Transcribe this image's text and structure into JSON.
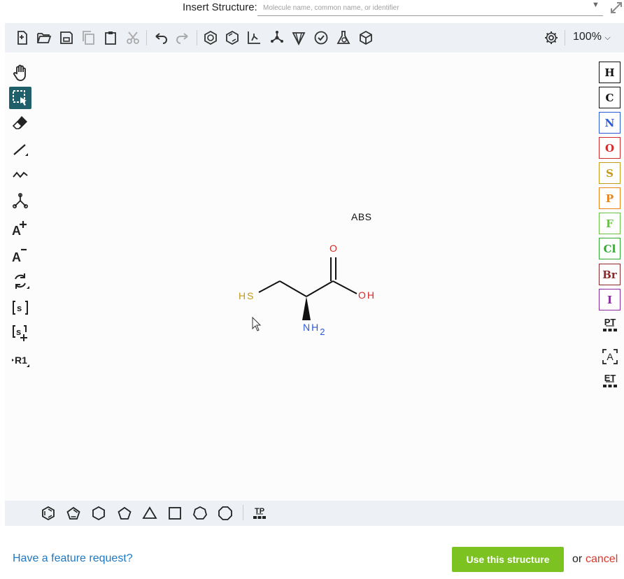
{
  "insert_structure": {
    "label": "Insert Structure:",
    "placeholder": "Molecule name, common name, or identifier"
  },
  "top_toolbar": {
    "zoom": "100%",
    "tools": [
      "new-document",
      "open",
      "save",
      "copy",
      "paste",
      "cut",
      "undo",
      "redo",
      "aromatize",
      "dearomatize",
      "layout",
      "clean",
      "stereo",
      "check",
      "calculate",
      "3d-view",
      "settings"
    ]
  },
  "left_toolbar": {
    "tools": [
      "hand",
      "select",
      "erase",
      "bond",
      "chain",
      "template-bond",
      "charge-plus",
      "charge-minus",
      "rotate",
      "sgroup",
      "sgroup-plus",
      "rgroup"
    ],
    "active": "select"
  },
  "right_toolbar": {
    "elements": [
      {
        "symbol": "H",
        "color": "#111111"
      },
      {
        "symbol": "C",
        "color": "#111111"
      },
      {
        "symbol": "N",
        "color": "#2a5bd7"
      },
      {
        "symbol": "O",
        "color": "#d22b2b"
      },
      {
        "symbol": "S",
        "color": "#c49a1a"
      },
      {
        "symbol": "P",
        "color": "#e8841c"
      },
      {
        "symbol": "F",
        "color": "#6ac246"
      },
      {
        "symbol": "Cl",
        "color": "#33a833"
      },
      {
        "symbol": "Br",
        "color": "#8b2a2a"
      },
      {
        "symbol": "I",
        "color": "#8a2a9e"
      }
    ],
    "periodic_table": "PT",
    "extended_table": "ET"
  },
  "molecule": {
    "abs": "ABS",
    "atoms": {
      "hs": "HS",
      "o": "O",
      "oh": "OH",
      "nh": "NH",
      "nh_sub": "2"
    }
  },
  "bottom_toolbar": {
    "templates": [
      "benzene",
      "cyclopentadiene",
      "cyclohexane",
      "cyclopentane",
      "cyclopropane",
      "cyclobutane",
      "cycloheptane",
      "cyclooctane"
    ],
    "template_library": "TP"
  },
  "footer": {
    "feature_request": "Have a feature request?",
    "use_button": "Use this structure",
    "or": "or",
    "cancel": "cancel"
  }
}
